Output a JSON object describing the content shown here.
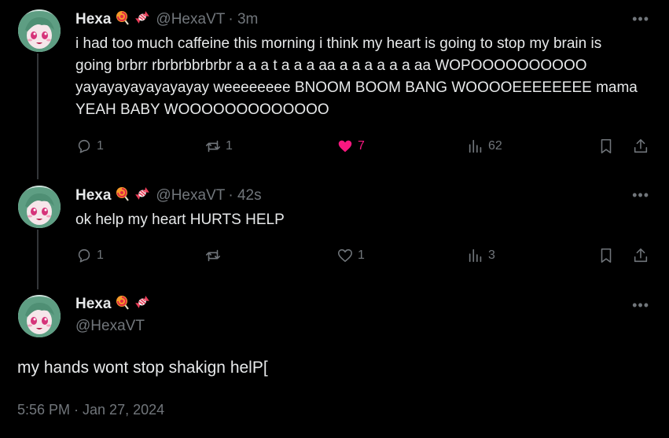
{
  "tweets": [
    {
      "name": "Hexa",
      "handle": "@HexaVT",
      "time": "· 3m",
      "text": "i had too much caffeine this morning i think my heart is going to stop my brain is going brbrr rbrbrbbrbrbr a a a t a a a aa a a a a a a aa WOPOOOOOOOOOO yayayayayayayayay weeeeeeee BNOOM BOOM BANG WOOOOEEEEEEEE mama YEAH BABY WOOOOOOOOOOOOO",
      "replies": "1",
      "retweets": "1",
      "likes": "7",
      "views": "62",
      "liked": true
    },
    {
      "name": "Hexa",
      "handle": "@HexaVT",
      "time": "· 42s",
      "text": "ok help my heart HURTS HELP",
      "replies": "1",
      "retweets": "",
      "likes": "1",
      "views": "3",
      "liked": false
    }
  ],
  "main": {
    "name": "Hexa",
    "handle": "@HexaVT",
    "text": "my hands wont stop shakign helP[",
    "timestamp": "5:56 PM · Jan 27, 2024"
  },
  "more_label": "•••",
  "icons": {
    "name_badges": [
      "lollipop-icon",
      "candy-icon"
    ],
    "actions": [
      "reply-icon",
      "retweet-icon",
      "like-icon",
      "views-icon",
      "bookmark-icon",
      "share-icon"
    ]
  },
  "colors": {
    "background": "#000000",
    "text": "#e7e9ea",
    "secondary": "#71767b",
    "like": "#f91880",
    "thread_line": "#333639"
  }
}
